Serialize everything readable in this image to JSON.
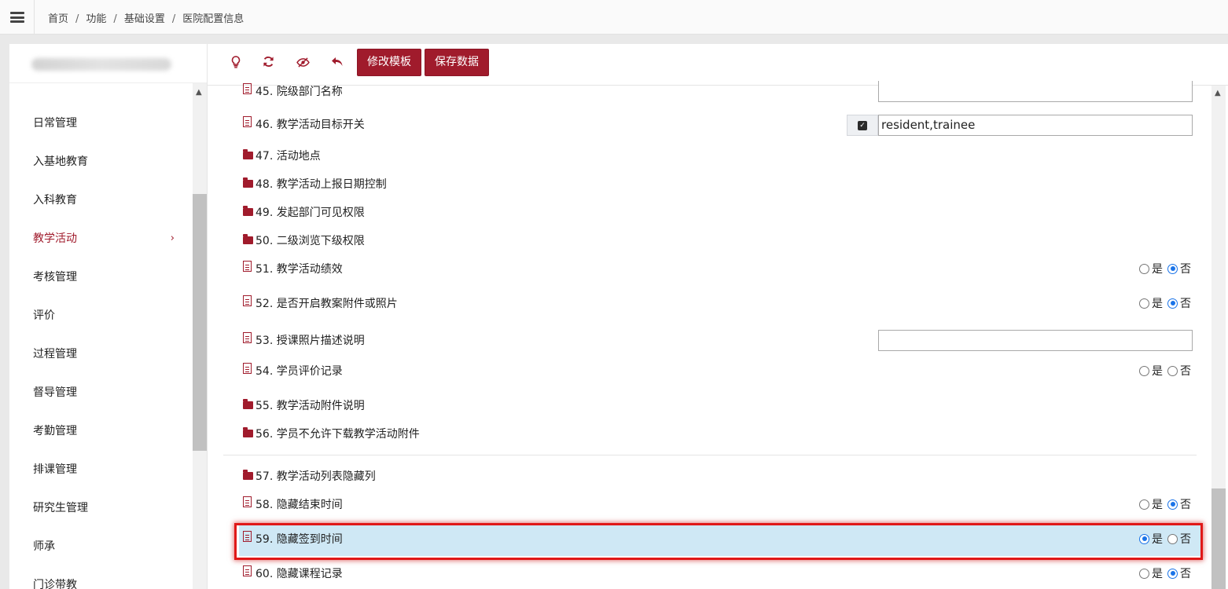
{
  "breadcrumb": {
    "items": [
      "首页",
      "功能",
      "基础设置",
      "医院配置信息"
    ],
    "separator": "/"
  },
  "sidebar": {
    "items": [
      {
        "label": "日常管理"
      },
      {
        "label": "入基地教育"
      },
      {
        "label": "入科教育"
      },
      {
        "label": "教学活动",
        "active": true,
        "chevron": "›"
      },
      {
        "label": "考核管理"
      },
      {
        "label": "评价"
      },
      {
        "label": "过程管理"
      },
      {
        "label": "督导管理"
      },
      {
        "label": "考勤管理"
      },
      {
        "label": "排课管理"
      },
      {
        "label": "研究生管理"
      },
      {
        "label": "师承"
      },
      {
        "label": "门诊带教"
      }
    ]
  },
  "toolbar": {
    "icons": [
      "lightbulb-icon",
      "refresh-icon",
      "eye-slash-icon",
      "undo-icon"
    ],
    "edit_template_label": "修改模板",
    "save_data_label": "保存数据"
  },
  "config": {
    "rows": [
      {
        "label": "45. 院级部门名称",
        "icon": "document-icon"
      },
      {
        "label": "46. 教学活动目标开关",
        "icon": "document-icon",
        "value": "resident,trainee",
        "checked": true
      },
      {
        "label": "47. 活动地点",
        "icon": "folder-icon"
      },
      {
        "label": "48. 教学活动上报日期控制",
        "icon": "folder-icon"
      },
      {
        "label": "49. 发起部门可见权限",
        "icon": "folder-icon"
      },
      {
        "label": "50. 二级浏览下级权限",
        "icon": "folder-icon"
      },
      {
        "label": "51. 教学活动绩效",
        "icon": "document-icon",
        "selected": "否"
      },
      {
        "label": "52. 是否开启教案附件或照片",
        "icon": "document-icon",
        "selected": "否"
      },
      {
        "label": "53. 授课照片描述说明",
        "icon": "document-icon",
        "value": ""
      },
      {
        "label": "54. 学员评价记录",
        "icon": "document-icon",
        "selected": ""
      },
      {
        "label": "55. 教学活动附件说明",
        "icon": "folder-icon"
      },
      {
        "label": "56. 学员不允许下载教学活动附件",
        "icon": "folder-icon"
      },
      {
        "label": "57. 教学活动列表隐藏列",
        "icon": "folder-icon"
      },
      {
        "label": "58. 隐藏结束时间",
        "icon": "document-icon",
        "selected": "否"
      },
      {
        "label": "59. 隐藏签到时间",
        "icon": "document-icon",
        "selected": "是",
        "highlighted": true
      },
      {
        "label": "60. 隐藏课程记录",
        "icon": "document-icon",
        "selected": "否"
      }
    ],
    "yes_label": "是",
    "no_label": "否"
  },
  "colors": {
    "brand": "#a01b2c",
    "radio_selected": "#1a73e8",
    "highlight_row": "#cfe8f5",
    "highlight_border": "#e01818"
  }
}
